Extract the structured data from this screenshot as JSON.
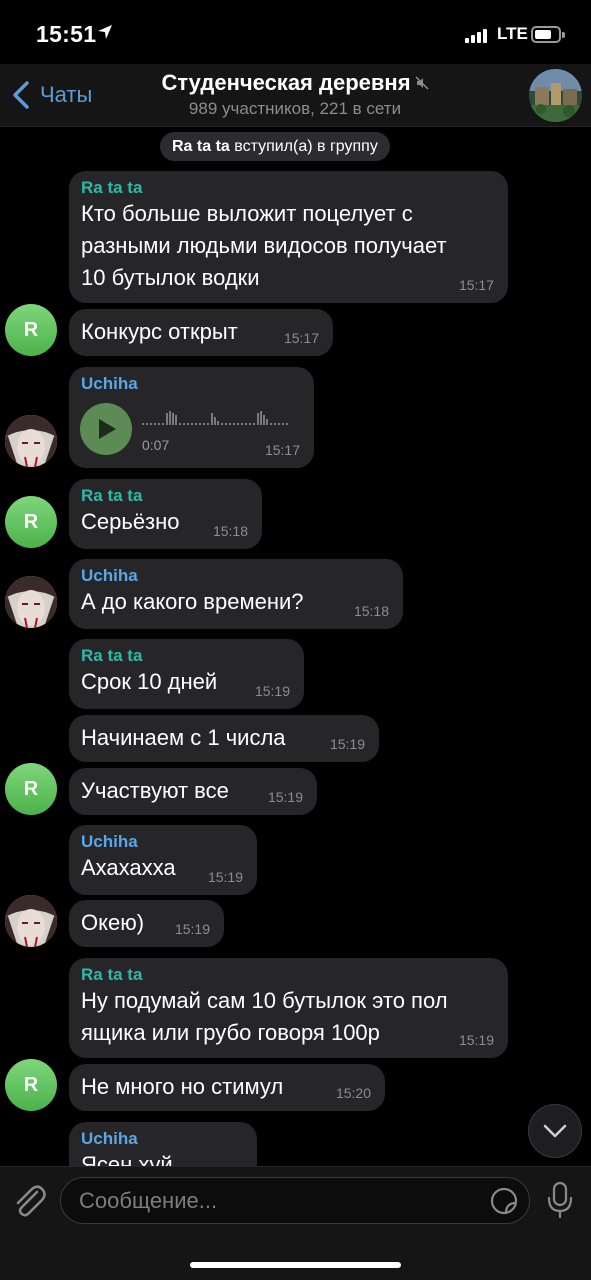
{
  "status": {
    "time": "15:51",
    "network": "LTE"
  },
  "header": {
    "back_label": "Чаты",
    "title": "Студенческая деревня",
    "subtitle": "989 участников, 221 в сети"
  },
  "system_message": {
    "name": "Ra ta ta",
    "action": "вступил(а) в группу"
  },
  "messages": [
    {
      "sender": "Ra ta ta",
      "text": "Кто больше выложит поцелует с\nразными людьми видосов получает\n10 бутылок водки",
      "time": "15:17"
    },
    {
      "text": "Конкурс открыт",
      "time": "15:17",
      "avatar": "R"
    },
    {
      "sender": "Uchiha",
      "voice_duration": "0:07",
      "time": "15:17"
    },
    {
      "sender": "Ra ta ta",
      "text": "Серьёзно",
      "time": "15:18",
      "avatar": "R"
    },
    {
      "sender": "Uchiha",
      "text": "А до какого времени?",
      "time": "15:18"
    },
    {
      "sender": "Ra ta ta",
      "text": "Срок 10 дней",
      "time": "15:19"
    },
    {
      "text": "Начинаем с 1 числа",
      "time": "15:19"
    },
    {
      "text": "Участвуют все",
      "time": "15:19",
      "avatar": "R"
    },
    {
      "sender": "Uchiha",
      "text": "Ахахахха",
      "time": "15:19"
    },
    {
      "text": "Окею)",
      "time": "15:19"
    },
    {
      "sender": "Ra ta ta",
      "text": "Ну подумай сам 10 бутылок это пол\nящика или грубо говоря 100р",
      "time": "15:19"
    },
    {
      "text": "Не много но стимул",
      "time": "15:20",
      "avatar": "R"
    },
    {
      "sender": "Uchiha",
      "text": "Ясен хуй"
    }
  ],
  "input": {
    "placeholder": "Сообщение..."
  },
  "colors": {
    "accent": "#5b9cd6",
    "bubble": "#262628",
    "ratata_name": "#2fb7a8",
    "uchiha_name": "#5aa6e8",
    "avatar_green": "#5cc058"
  }
}
